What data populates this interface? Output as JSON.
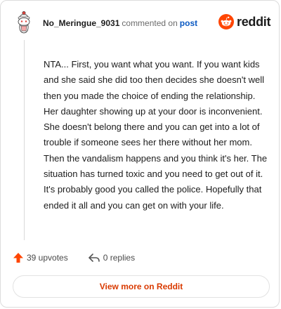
{
  "header": {
    "username": "No_Meringue_9031",
    "commented_text": "commented on",
    "post_link": "post",
    "brand": "reddit"
  },
  "comment": {
    "text": "NTA... First, you want what you want. If you want kids and she said she did too then decides she doesn't well then you made the choice of ending the relationship. Her daughter showing up at your door is inconvenient. She doesn't belong there and you can get into a lot of trouble if someone sees her there without her mom. Then the vandalism happens and you think it's her. The situation has turned toxic and you need to get out of it. It's probably good you called the police. Hopefully that ended it all and you can get on with your life."
  },
  "actions": {
    "upvotes": "39 upvotes",
    "replies": "0 replies"
  },
  "footer": {
    "view_more": "View more on Reddit"
  },
  "colors": {
    "accent": "#d93a00",
    "link": "#0a59c2",
    "upvote": "#ff4500"
  },
  "icons": {
    "avatar": "snoo-avatar",
    "logo": "reddit-snoo-icon",
    "upvote": "upvote-arrow-icon",
    "reply": "reply-arrow-icon"
  }
}
